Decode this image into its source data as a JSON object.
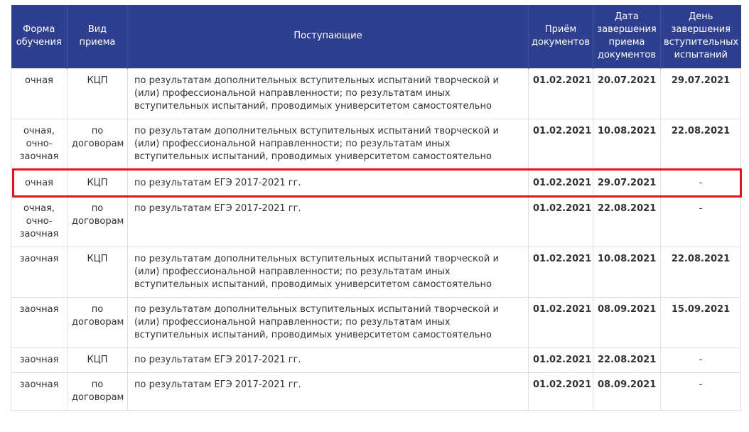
{
  "headers": {
    "form": "Форма обучения",
    "type": "Вид приема",
    "applicants": "Поступающие",
    "docs_start": "Приём документов",
    "docs_end": "Дата завершения приема документов",
    "exam_end": "День завершения вступительных испытаний"
  },
  "rows": [
    {
      "form": "очная",
      "type": "КЦП",
      "applicants": "по результатам дополнительных вступительных испытаний творческой и (или) профессиональной направленности; по результатам иных вступительных испытаний, проводимых университетом самостоятельно",
      "start": "01.02.2021",
      "end": "20.07.2021",
      "exam": "29.07.2021"
    },
    {
      "form": "очная, очно-заочная",
      "type": "по договорам",
      "applicants": "по результатам дополнительных вступительных испытаний творческой и (или) профессиональной направленности; по результатам иных вступительных испытаний, проводимых университетом самостоятельно",
      "start": "01.02.2021",
      "end": "10.08.2021",
      "exam": "22.08.2021"
    },
    {
      "form": "очная",
      "type": "КЦП",
      "applicants": "по результатам ЕГЭ 2017-2021 гг.",
      "start": "01.02.2021",
      "end": "29.07.2021",
      "exam": "-"
    },
    {
      "form": "очная, очно-заочная",
      "type": "по договорам",
      "applicants": "по результатам ЕГЭ 2017-2021 гг.",
      "start": "01.02.2021",
      "end": "22.08.2021",
      "exam": "-"
    },
    {
      "form": "заочная",
      "type": "КЦП",
      "applicants": "по результатам дополнительных вступительных испытаний творческой и (или) профессиональной направленности; по результатам иных вступительных испытаний, проводимых университетом самостоятельно",
      "start": "01.02.2021",
      "end": "10.08.2021",
      "exam": "22.08.2021"
    },
    {
      "form": "заочная",
      "type": "по договорам",
      "applicants": "по результатам дополнительных вступительных испытаний творческой и (или) профессиональной направленности; по результатам иных вступительных испытаний, проводимых университетом самостоятельно",
      "start": "01.02.2021",
      "end": "08.09.2021",
      "exam": "15.09.2021"
    },
    {
      "form": "заочная",
      "type": "КЦП",
      "applicants": "по результатам ЕГЭ 2017-2021 гг.",
      "start": "01.02.2021",
      "end": "22.08.2021",
      "exam": "-"
    },
    {
      "form": "заочная",
      "type": "по договорам",
      "applicants": "по результатам ЕГЭ 2017-2021 гг.",
      "start": "01.02.2021",
      "end": "08.09.2021",
      "exam": "-"
    }
  ],
  "colors": {
    "header_bg": "#2f3f8f",
    "highlight": "#e0141b"
  }
}
